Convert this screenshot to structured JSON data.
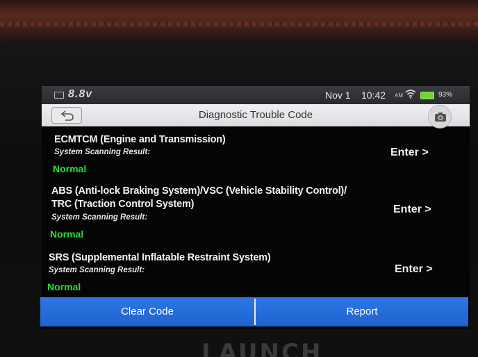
{
  "status_bar": {
    "voltage": "8.8v",
    "date": "Nov 1",
    "time": "10:42",
    "ampm": "AM",
    "battery_percent": "93%",
    "battery_level": 0.93,
    "icons": [
      "battery-icon",
      "wifi-icon",
      "battery-level-icon"
    ],
    "battery_color": "#6fd436"
  },
  "header": {
    "title": "Diagnostic Trouble Code",
    "back_icon": "back-arrow-icon",
    "camera_icon": "camera-icon"
  },
  "systems": [
    {
      "name_line1": "ECMTCM (Engine and Transmission)",
      "name_line2": "",
      "result_label": "System Scanning Result:",
      "status": "Normal",
      "action": "Enter >"
    },
    {
      "name_line1": "ABS (Anti-lock Braking System)/VSC (Vehicle Stability Control)/",
      "name_line2": "TRC (Traction Control System)",
      "result_label": "System Scanning Result:",
      "status": "Normal",
      "action": "Enter >"
    },
    {
      "name_line1": "SRS (Supplemental Inflatable Restraint System)",
      "name_line2": "",
      "result_label": "System Scanning Result:",
      "status": "Normal",
      "action": "Enter >"
    }
  ],
  "footer": {
    "clear_label": "Clear Code",
    "report_label": "Report",
    "accent": "#2d77e6"
  },
  "colors": {
    "status_normal": "#1fe23a"
  },
  "device_brand": "LAUNCH"
}
